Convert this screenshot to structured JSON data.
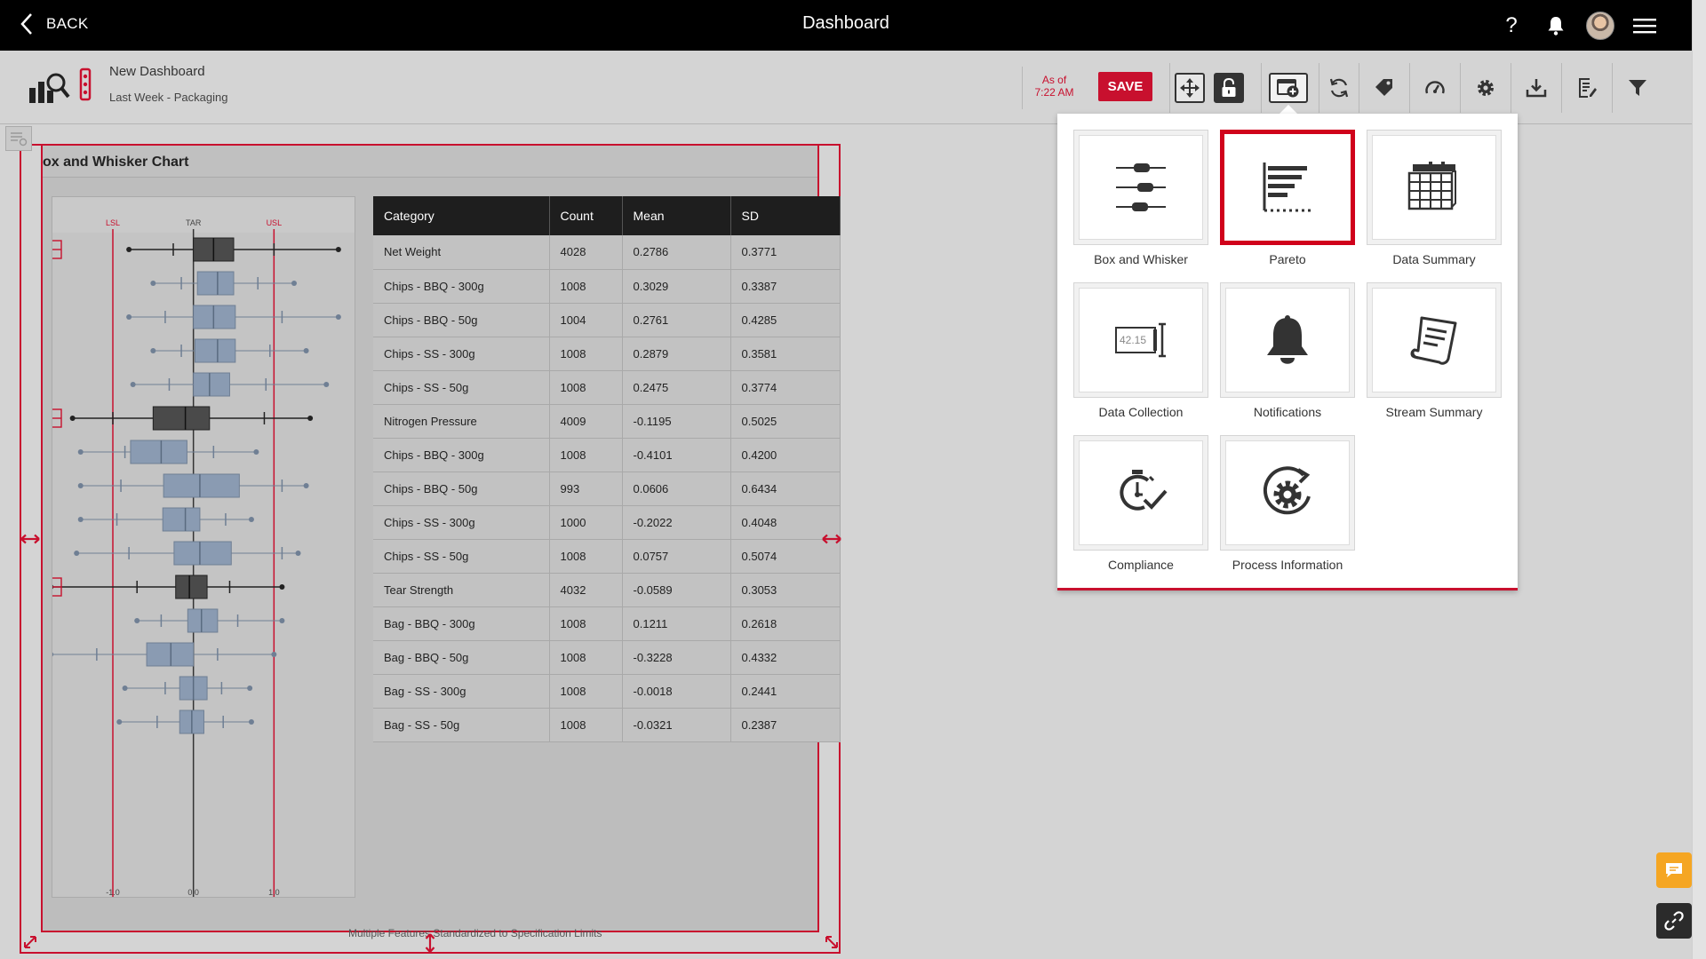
{
  "topbar": {
    "back_label": "BACK",
    "title": "Dashboard"
  },
  "toolbar": {
    "dashboard_name": "New Dashboard",
    "dashboard_subtitle": "Last Week - Packaging",
    "asof_line1": "As of",
    "asof_line2": "7:22 AM",
    "save_label": "SAVE"
  },
  "widget": {
    "title": "ox and Whisker Chart",
    "footer_note": "Multiple Features Standardized to Specification Limits"
  },
  "chart_data": {
    "type": "box",
    "title": "ox and Whisker Chart",
    "reference_lines": [
      {
        "label": "LSL",
        "x": -1.0
      },
      {
        "label": "TAR",
        "x": 0.0
      },
      {
        "label": "USL",
        "x": 1.0
      }
    ],
    "x_ticks": [
      "-1.0",
      "0.0",
      "1.0"
    ],
    "xlim": [
      -1.75,
      2.0
    ],
    "categories": [
      "Net Weight",
      "Chips - BBQ - 300g",
      "Chips - BBQ - 50g",
      "Chips - SS - 300g",
      "Chips - SS - 50g",
      "Nitrogen Pressure",
      "Chips - BBQ - 300g",
      "Chips - BBQ - 50g",
      "Chips - SS - 300g",
      "Chips - SS - 50g",
      "Tear Strength",
      "Bag - BBQ - 300g",
      "Bag - BBQ - 50g",
      "Bag - SS - 300g",
      "Bag - SS - 50g"
    ],
    "groups": [
      true,
      false,
      false,
      false,
      false,
      true,
      false,
      false,
      false,
      false,
      true,
      false,
      false,
      false,
      false
    ],
    "boxes": [
      {
        "min": -0.8,
        "wl": -0.25,
        "q1": 0.0,
        "med": 0.25,
        "q3": 0.5,
        "wh": 1.0,
        "max": 1.8
      },
      {
        "min": -0.5,
        "wl": -0.15,
        "q1": 0.05,
        "med": 0.3,
        "q3": 0.5,
        "wh": 0.8,
        "max": 1.25
      },
      {
        "min": -0.8,
        "wl": -0.35,
        "q1": 0.0,
        "med": 0.25,
        "q3": 0.52,
        "wh": 1.1,
        "max": 1.8
      },
      {
        "min": -0.5,
        "wl": -0.15,
        "q1": 0.02,
        "med": 0.3,
        "q3": 0.52,
        "wh": 0.95,
        "max": 1.4
      },
      {
        "min": -0.75,
        "wl": -0.3,
        "q1": 0.0,
        "med": 0.2,
        "q3": 0.45,
        "wh": 0.9,
        "max": 1.65
      },
      {
        "min": -1.5,
        "wl": -1.0,
        "q1": -0.5,
        "med": -0.1,
        "q3": 0.2,
        "wh": 0.88,
        "max": 1.45
      },
      {
        "min": -1.4,
        "wl": -0.85,
        "q1": -0.78,
        "med": -0.4,
        "q3": -0.08,
        "wh": 0.25,
        "max": 0.78
      },
      {
        "min": -1.4,
        "wl": -0.9,
        "q1": -0.37,
        "med": 0.08,
        "q3": 0.57,
        "wh": 1.1,
        "max": 1.4
      },
      {
        "min": -1.4,
        "wl": -0.95,
        "q1": -0.38,
        "med": -0.1,
        "q3": 0.08,
        "wh": 0.4,
        "max": 0.72
      },
      {
        "min": -1.45,
        "wl": -0.8,
        "q1": -0.24,
        "med": 0.08,
        "q3": 0.47,
        "wh": 1.1,
        "max": 1.3
      },
      {
        "min": -1.77,
        "wl": -0.7,
        "q1": -0.22,
        "med": -0.05,
        "q3": 0.17,
        "wh": 0.45,
        "max": 1.1
      },
      {
        "min": -0.7,
        "wl": -0.4,
        "q1": -0.07,
        "med": 0.1,
        "q3": 0.3,
        "wh": 0.55,
        "max": 1.1
      },
      {
        "min": -1.77,
        "wl": -1.2,
        "q1": -0.58,
        "med": -0.28,
        "q3": 0.0,
        "wh": 0.3,
        "max": 1.0
      },
      {
        "min": -0.85,
        "wl": -0.35,
        "q1": -0.17,
        "med": 0.0,
        "q3": 0.17,
        "wh": 0.35,
        "max": 0.7
      },
      {
        "min": -0.92,
        "wl": -0.45,
        "q1": -0.17,
        "med": -0.02,
        "q3": 0.13,
        "wh": 0.37,
        "max": 0.72
      }
    ]
  },
  "table": {
    "headers": [
      "Category",
      "Count",
      "Mean",
      "SD"
    ],
    "rows": [
      [
        "Net Weight",
        "4028",
        "0.2786",
        "0.3771"
      ],
      [
        "Chips - BBQ - 300g",
        "1008",
        "0.3029",
        "0.3387"
      ],
      [
        "Chips - BBQ - 50g",
        "1004",
        "0.2761",
        "0.4285"
      ],
      [
        "Chips - SS - 300g",
        "1008",
        "0.2879",
        "0.3581"
      ],
      [
        "Chips - SS - 50g",
        "1008",
        "0.2475",
        "0.3774"
      ],
      [
        "Nitrogen Pressure",
        "4009",
        "-0.1195",
        "0.5025"
      ],
      [
        "Chips - BBQ - 300g",
        "1008",
        "-0.4101",
        "0.4200"
      ],
      [
        "Chips - BBQ - 50g",
        "993",
        "0.0606",
        "0.6434"
      ],
      [
        "Chips - SS - 300g",
        "1000",
        "-0.2022",
        "0.4048"
      ],
      [
        "Chips - SS - 50g",
        "1008",
        "0.0757",
        "0.5074"
      ],
      [
        "Tear Strength",
        "4032",
        "-0.0589",
        "0.3053"
      ],
      [
        "Bag - BBQ - 300g",
        "1008",
        "0.1211",
        "0.2618"
      ],
      [
        "Bag - BBQ - 50g",
        "1008",
        "-0.3228",
        "0.4332"
      ],
      [
        "Bag - SS - 300g",
        "1008",
        "-0.0018",
        "0.2441"
      ],
      [
        "Bag - SS - 50g",
        "1008",
        "-0.0321",
        "0.2387"
      ]
    ]
  },
  "panel": {
    "tiles": [
      {
        "label": "Box and Whisker",
        "icon": "box-whisker-icon"
      },
      {
        "label": "Pareto",
        "icon": "pareto-icon",
        "selected": true
      },
      {
        "label": "Data Summary",
        "icon": "data-summary-icon"
      },
      {
        "label": "Data Collection",
        "icon": "data-collection-icon",
        "icon_text": "42.15"
      },
      {
        "label": "Notifications",
        "icon": "bell-icon"
      },
      {
        "label": "Stream Summary",
        "icon": "stream-summary-icon"
      },
      {
        "label": "Compliance",
        "icon": "compliance-icon"
      },
      {
        "label": "Process Information",
        "icon": "process-information-icon"
      }
    ]
  },
  "colors": {
    "accent": "#c8102e",
    "topbar": "#000000",
    "background": "#d4d4d4",
    "chat_button": "#f5a623",
    "link_button": "#2b2b2b"
  }
}
